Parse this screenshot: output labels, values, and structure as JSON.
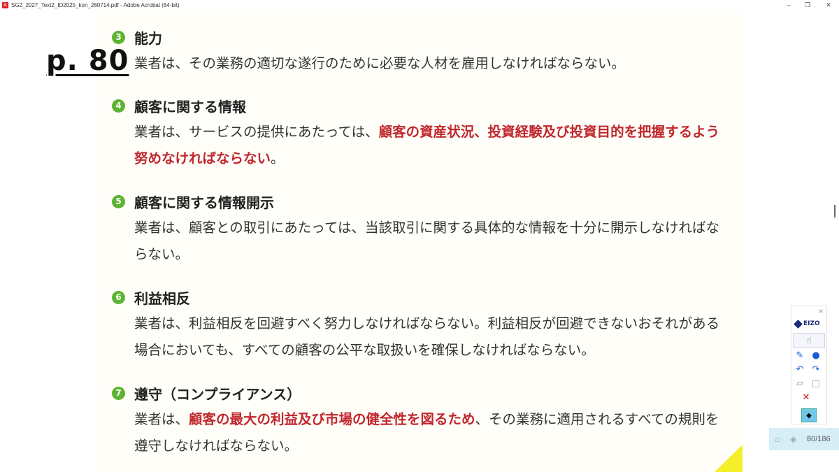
{
  "window": {
    "title": "SG2_2027_Text2_ID2025_kon_260714.pdf - Adobe Acrobat (64-bit)",
    "minimize": "–",
    "maximize": "❐",
    "close": "✕"
  },
  "page_label": "p. 80",
  "sections": [
    {
      "number": "3",
      "heading": "能力",
      "body": [
        {
          "text": "業者は、その業務の適切な遂行のために必要な人材を雇用しなければならない。"
        }
      ]
    },
    {
      "number": "4",
      "heading": "顧客に関する情報",
      "body": [
        {
          "text": "業者は、サービスの提供にあたっては、"
        },
        {
          "text": "顧客の資産状況、投資経験及び投資目的を把握するよう努めなければならない",
          "emphasis": true
        },
        {
          "text": "。"
        }
      ]
    },
    {
      "number": "5",
      "heading": "顧客に関する情報開示",
      "body": [
        {
          "text": "業者は、顧客との取引にあたっては、当該取引に関する具体的な情報を十分に開示しなければならない。"
        }
      ]
    },
    {
      "number": "6",
      "heading": "利益相反",
      "body": [
        {
          "text": "業者は、利益相反を回避すべく努力しなければならない。利益相反が回避できないおそれがある場合においても、すべての顧客の公平な取扱いを確保しなければならない。"
        }
      ]
    },
    {
      "number": "7",
      "heading": "遵守（コンプライアンス）",
      "body": [
        {
          "text": "業者は、"
        },
        {
          "text": "顧客の最大の利益及び市場の健全性を図るため",
          "emphasis": true
        },
        {
          "text": "、その業務に適用されるすべての規則を遵守しなければならない。"
        }
      ]
    }
  ],
  "toolbar": {
    "logo_text": "EIZO",
    "close": "×"
  },
  "page_indicator": {
    "text": "80/186"
  },
  "colors": {
    "badge": "#5cb531",
    "emphasis": "#c1272d",
    "page_bg": "#fffef9",
    "corner": "#f5ef2a"
  }
}
